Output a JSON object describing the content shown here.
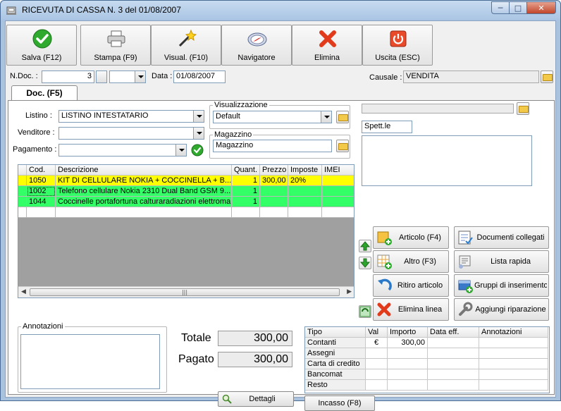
{
  "window": {
    "title": "RICEVUTA DI CASSA N. 3  del 01/08/2007"
  },
  "toolbar": {
    "save": "Salva (F12)",
    "print": "Stampa (F9)",
    "view": "Visual. (F10)",
    "navigator": "Navigatore",
    "delete": "Elimina",
    "exit": "Uscita (ESC)"
  },
  "header": {
    "ndoc_label": "N.Doc. :",
    "ndoc_value": "3",
    "data_label": "Data :",
    "data_value": "01/08/2007",
    "causale_label": "Causale :",
    "causale_value": "VENDITA"
  },
  "tab": {
    "label": "Doc. (F5)"
  },
  "form": {
    "listino_label": "Listino :",
    "listino_value": "LISTINO INTESTATARIO",
    "venditore_label": "Venditore :",
    "venditore_value": "",
    "pagamento_label": "Pagamento :",
    "pagamento_value": "",
    "visualizzazione_legend": "Visualizzazione",
    "visualizzazione_value": "Default",
    "magazzino_legend": "Magazzino",
    "magazzino_value": "Magazzino",
    "spett_value": "Spett.le"
  },
  "grid": {
    "columns": [
      "Cod.",
      "Descrizione",
      "Quant.",
      "Prezzo",
      "Imposte",
      "IMEI"
    ],
    "rows": [
      {
        "cod": "1050",
        "desc": "KIT DI CELLULARE NOKIA + COCCINELLA + B...",
        "qty": "1",
        "price": "300,00",
        "tax": "20%",
        "imei": ""
      },
      {
        "cod": "1002",
        "desc": "Telefono cellulare Nokia 2310 Dual Band GSM 9...",
        "qty": "1",
        "price": "",
        "tax": "",
        "imei": ""
      },
      {
        "cod": "1044",
        "desc": "Coccinelle portafortuna calturaradiazioni elettroma...",
        "qty": "1",
        "price": "",
        "tax": "",
        "imei": ""
      }
    ]
  },
  "actions": {
    "articolo": "Articolo (F4)",
    "documenti": "Documenti collegati",
    "altro": "Altro (F3)",
    "lista": "Lista rapida",
    "ritiro": "Ritiro articolo",
    "gruppi": "Gruppi di inserimento",
    "elimina_linea": "Elimina linea",
    "riparazione": "Aggiungi riparazione"
  },
  "notes": {
    "legend": "Annotazioni"
  },
  "totals": {
    "totale_label": "Totale",
    "totale_value": "300,00",
    "pagato_label": "Pagato",
    "pagato_value": "300,00",
    "dettagli": "Dettagli"
  },
  "payments": {
    "columns": [
      "Tipo",
      "Val",
      "Importo",
      "Data eff.",
      "Annotazioni"
    ],
    "rows": [
      {
        "tipo": "Contanti",
        "val": "€",
        "importo": "300,00"
      },
      {
        "tipo": "Assegni",
        "val": "",
        "importo": ""
      },
      {
        "tipo": "Carta di credito",
        "val": "",
        "importo": ""
      },
      {
        "tipo": "Bancomat",
        "val": "",
        "importo": ""
      },
      {
        "tipo": "Resto",
        "val": "",
        "importo": ""
      }
    ],
    "incasso": "Incasso (F8)"
  },
  "colors": {
    "row_highlight": "#ffff00",
    "row_green": "#33ff66",
    "title_bar": "#b9d1ea"
  }
}
